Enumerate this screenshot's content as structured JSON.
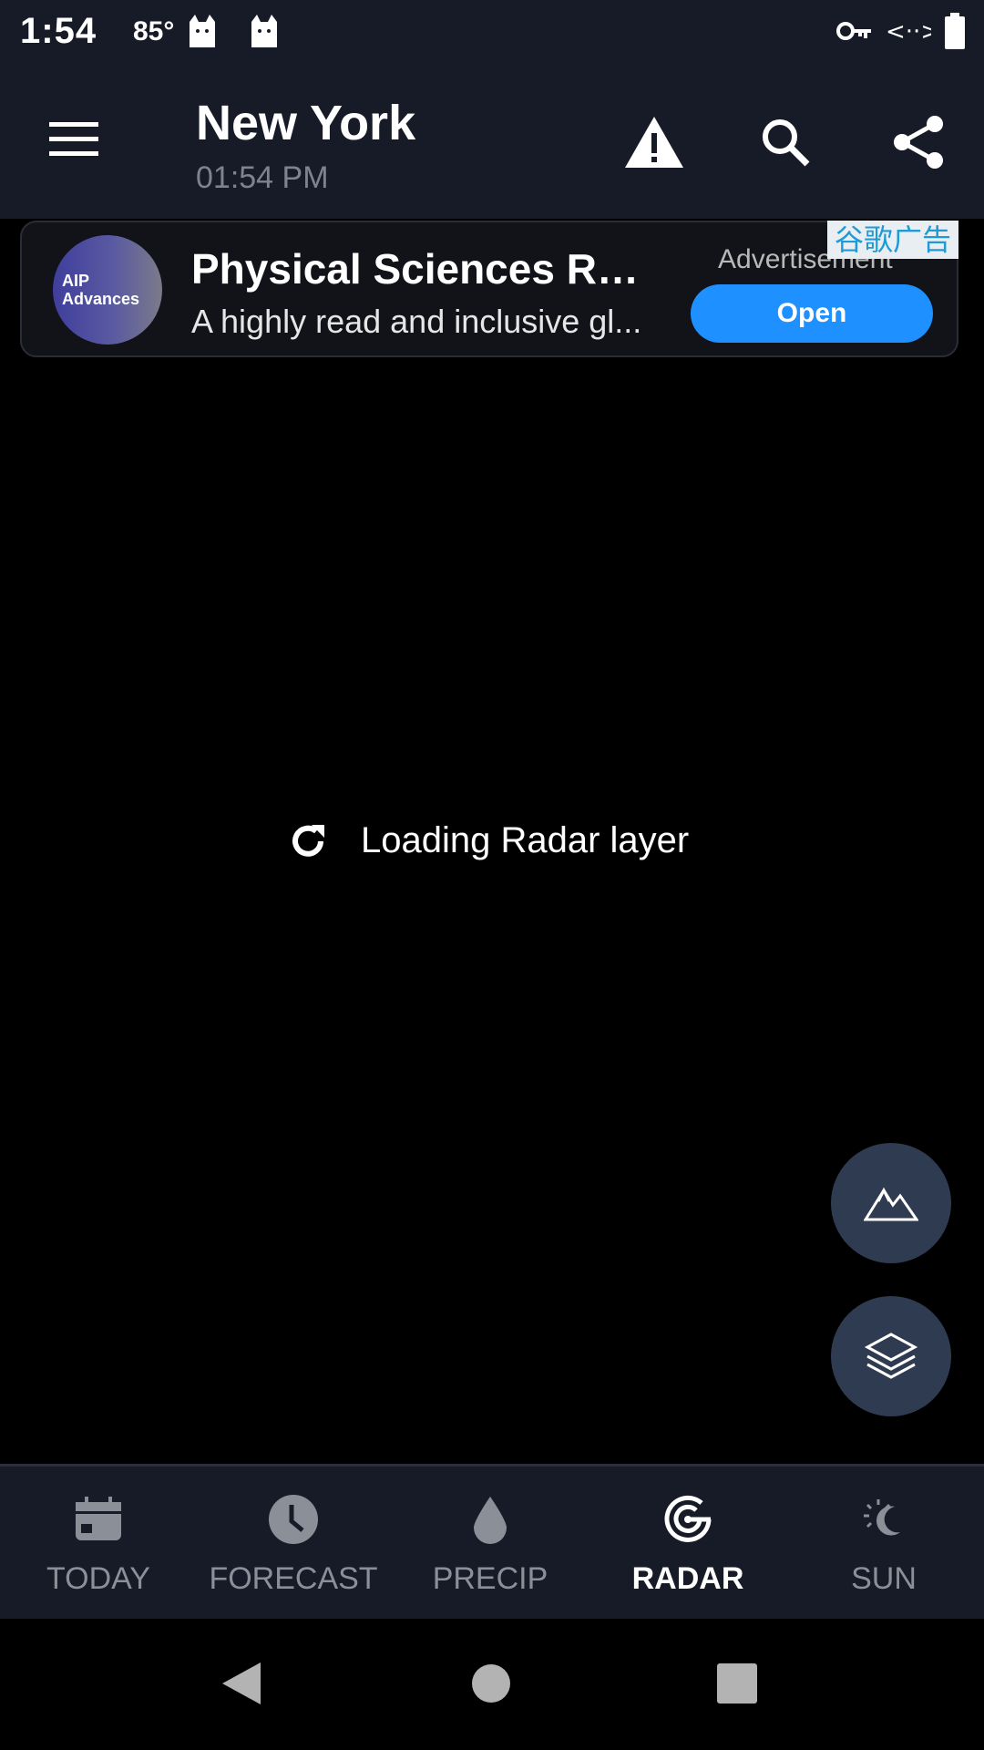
{
  "status_bar": {
    "time": "1:54",
    "temperature": "85°"
  },
  "header": {
    "city": "New York",
    "time": "01:54 PM",
    "icons": [
      "menu-icon",
      "warning-icon",
      "search-icon",
      "share-icon"
    ]
  },
  "ad": {
    "logo_text_line1": "AIP",
    "logo_text_line2": "Advances",
    "title": "Physical Sciences Re...",
    "description": "A highly read and inclusive gl...",
    "label": "Advertisement",
    "tag": "谷歌广告",
    "open_label": "Open",
    "accent": "#1e90ff"
  },
  "map": {
    "loading_text": "Loading Radar layer",
    "fabs": [
      "terrain-icon",
      "layers-icon"
    ]
  },
  "bottom_nav": {
    "items": [
      {
        "label": "TODAY",
        "icon": "calendar-icon",
        "active": false
      },
      {
        "label": "FORECAST",
        "icon": "clock-icon",
        "active": false
      },
      {
        "label": "PRECIP",
        "icon": "drop-icon",
        "active": false
      },
      {
        "label": "RADAR",
        "icon": "radar-icon",
        "active": true
      },
      {
        "label": "SUN",
        "icon": "sun-moon-icon",
        "active": false
      }
    ]
  },
  "system_nav": [
    "back-icon",
    "home-icon",
    "recents-icon"
  ]
}
